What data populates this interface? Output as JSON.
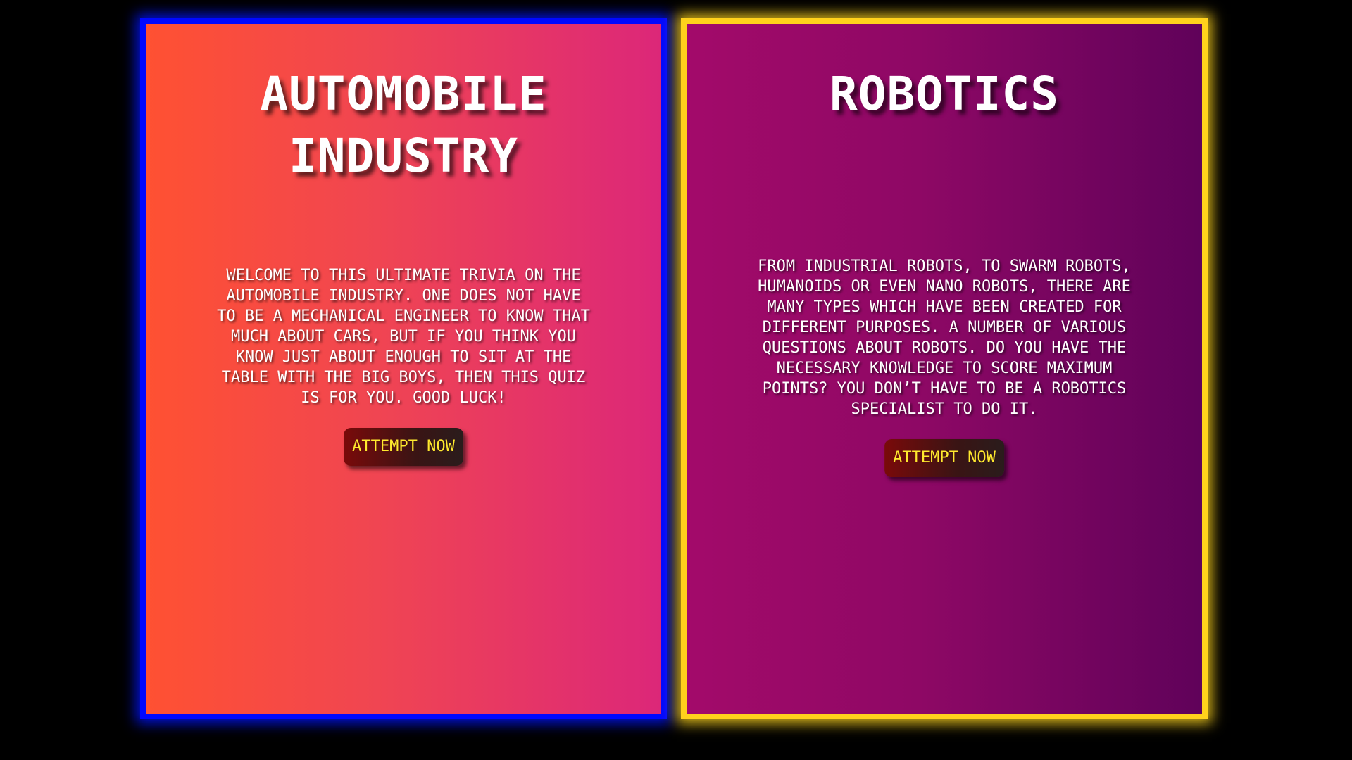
{
  "cards": [
    {
      "title": "AUTOMOBILE INDUSTRY",
      "description": "WELCOME TO THIS ULTIMATE TRIVIA ON THE AUTOMOBILE INDUSTRY. ONE DOES NOT HAVE TO BE A MECHANICAL ENGINEER TO KNOW THAT MUCH ABOUT CARS, BUT IF YOU THINK YOU KNOW JUST ABOUT ENOUGH TO SIT AT THE TABLE WITH THE BIG BOYS, THEN THIS QUIZ IS FOR YOU. GOOD LUCK!",
      "button_label": "ATTEMPT NOW",
      "border_color": "#0008ff",
      "gradient": [
        "#ff5132",
        "#dc2779"
      ]
    },
    {
      "title": "ROBOTICS",
      "description": "FROM INDUSTRIAL ROBOTS, TO SWARM ROBOTS, HUMANOIDS OR EVEN NANO ROBOTS, THERE ARE MANY TYPES WHICH HAVE BEEN CREATED FOR DIFFERENT PURPOSES. A NUMBER OF VARIOUS QUESTIONS ABOUT ROBOTS. DO YOU HAVE THE NECESSARY KNOWLEDGE TO SCORE MAXIMUM POINTS? YOU DON’T HAVE TO BE A ROBOTICS SPECIALIST TO DO IT.",
      "button_label": "ATTEMPT NOW",
      "border_color": "#ffd21c",
      "gradient": [
        "#a30a6a",
        "#60025a"
      ]
    }
  ],
  "colors": {
    "page_background": "#000000",
    "button_text": "#ffea2e"
  }
}
